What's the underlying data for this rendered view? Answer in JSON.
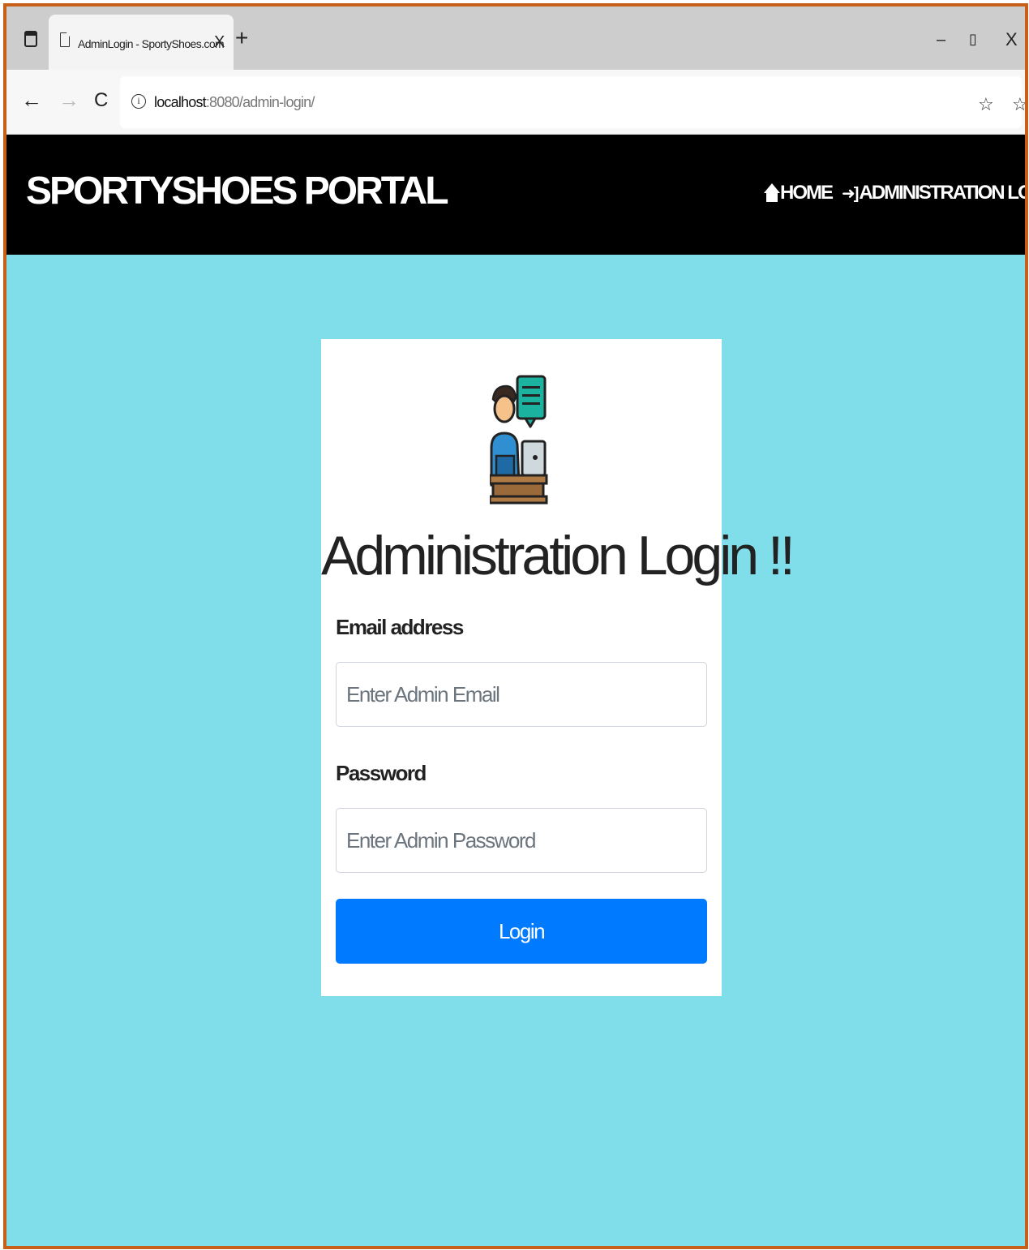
{
  "browser": {
    "tab": {
      "title": "AdminLogin - SportyShoes.com",
      "close": "X"
    },
    "new_tab": "+",
    "window": {
      "minimize": "–",
      "maximize": "▯",
      "close": "X"
    },
    "nav": {
      "back": "←",
      "forward": "→",
      "reload": "C"
    },
    "address": {
      "info": "i",
      "host": "localhost",
      "rest": ":8080/admin-login/"
    },
    "toolbar": {
      "add_favorite": "☆",
      "favorites": "☆",
      "collections": "⧉",
      "more": "···"
    }
  },
  "navbar": {
    "brand": "SPORTYSHOES PORTAL",
    "links": [
      {
        "label": "HOME",
        "icon": "home-icon"
      },
      {
        "label": "ADMINISTRATION LOGIN",
        "icon": "sign-in-icon",
        "icon_glyph": "➜]"
      }
    ]
  },
  "login": {
    "title": "Administration Login !!",
    "email_label": "Email address",
    "email_placeholder": "Enter Admin Email",
    "email_value": "",
    "password_label": "Password",
    "password_placeholder": "Enter Admin Password",
    "password_value": "",
    "button_label": "Login"
  },
  "colors": {
    "page_background": "#80deea",
    "navbar_background": "#000000",
    "button_primary": "#007bff",
    "frame_border": "#c8601a"
  }
}
